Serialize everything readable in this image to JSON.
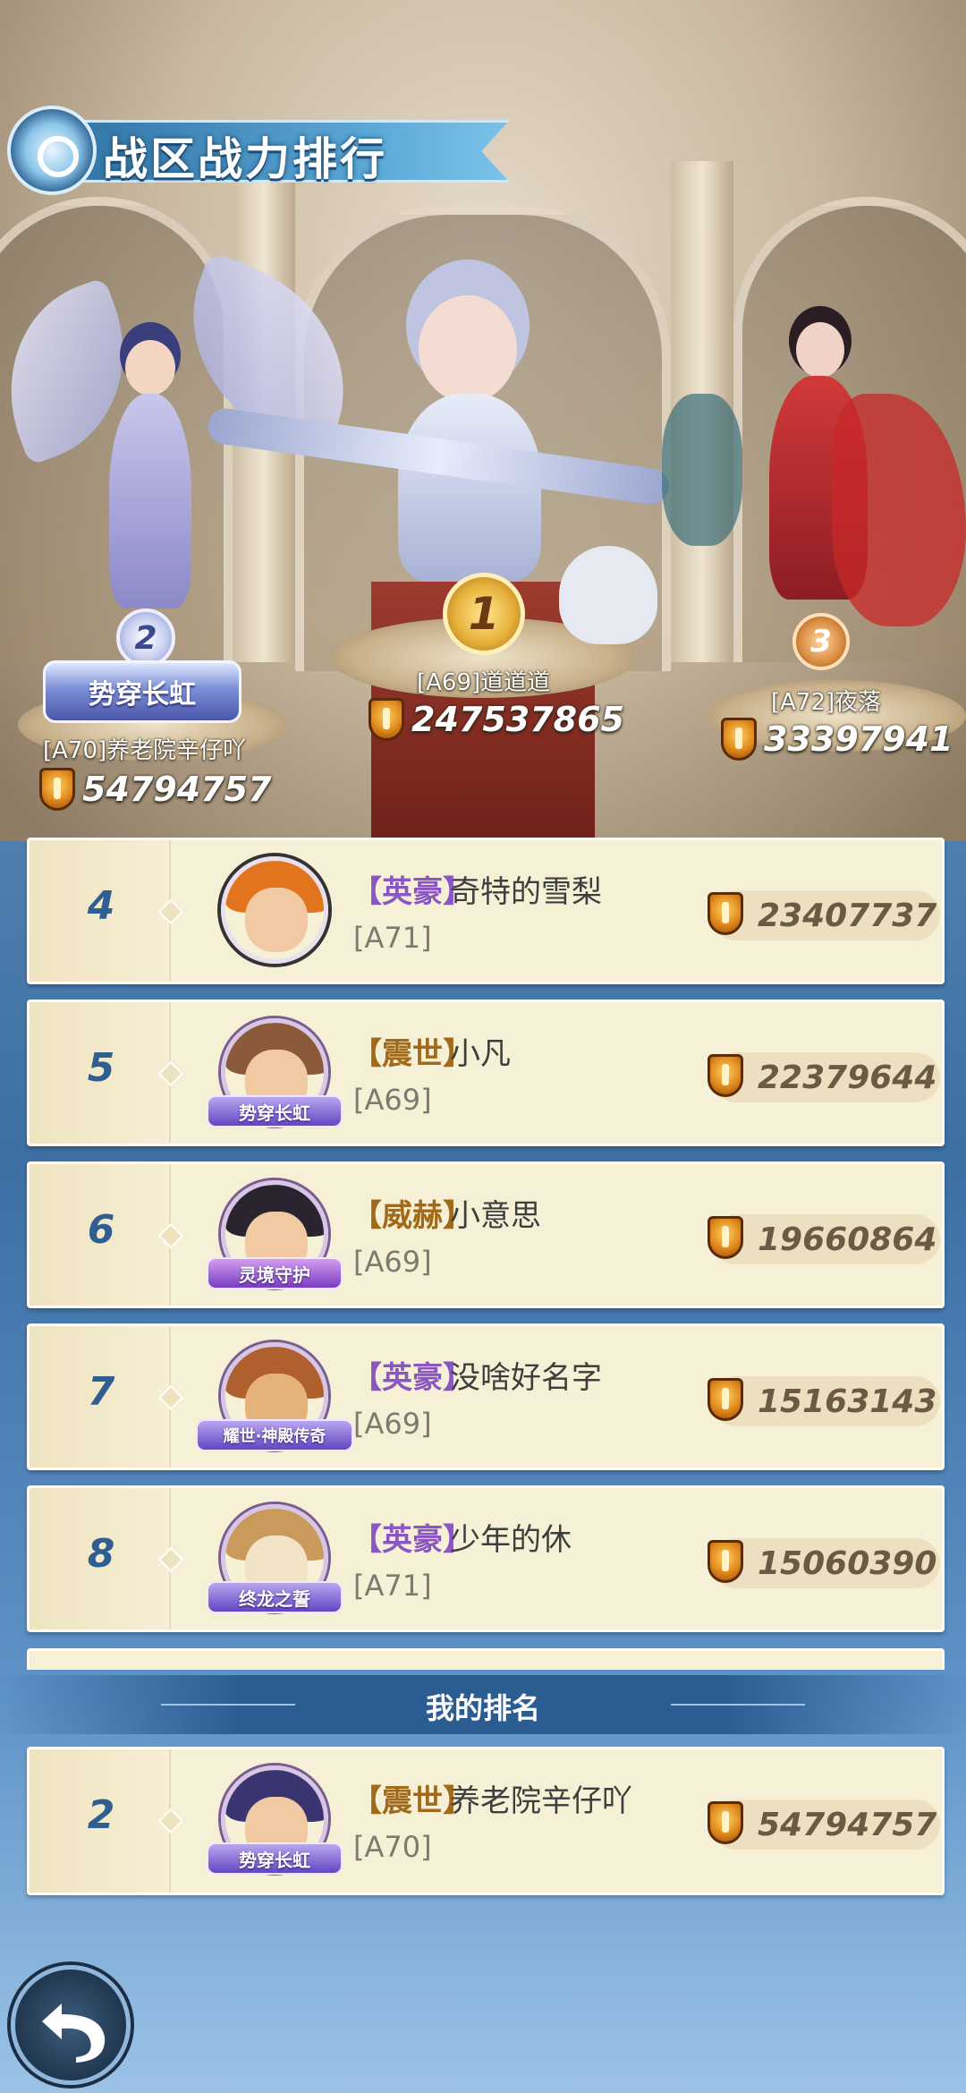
{
  "page_title": "战区战力排行",
  "podium": [
    {
      "rank": "2",
      "title_plate": "势穿长虹",
      "name": "[A70]养老院辛仔吖",
      "power": "54794757"
    },
    {
      "rank": "1",
      "name": "[A69]道道道",
      "power": "247537865"
    },
    {
      "rank": "3",
      "name": "[A72]夜落",
      "power": "33397941"
    }
  ],
  "rows": [
    {
      "rank": "4",
      "tag": "【英豪】",
      "name": "奇特的雪梨",
      "server": "[A71]",
      "power": "23407737",
      "frame": ""
    },
    {
      "rank": "5",
      "tag": "【震世】",
      "name": "小凡",
      "server": "[A69]",
      "power": "22379644",
      "frame": "势穿长虹"
    },
    {
      "rank": "6",
      "tag": "【威赫】",
      "name": "小意思",
      "server": "[A69]",
      "power": "19660864",
      "frame": "灵境守护"
    },
    {
      "rank": "7",
      "tag": "【英豪】",
      "name": "没啥好名字",
      "server": "[A69]",
      "power": "15163143",
      "frame": "耀世·神殿传奇"
    },
    {
      "rank": "8",
      "tag": "【英豪】",
      "name": "少年的休",
      "server": "[A71]",
      "power": "15060390",
      "frame": "终龙之誓"
    }
  ],
  "my_ranking": {
    "label": "我的排名",
    "rank": "2",
    "tag": "【震世】",
    "name": "养老院辛仔吖",
    "server": "[A70]",
    "power": "54794757",
    "frame": "势穿长虹"
  },
  "colors": {
    "accent": "#2f5f90",
    "row_bg": "#f6f0d6",
    "tag_purple": "#8a56c2",
    "tag_gold": "#a06a1a"
  },
  "icons": [
    "title-emblem-icon",
    "power-shield-icon",
    "back-arrow-icon"
  ]
}
